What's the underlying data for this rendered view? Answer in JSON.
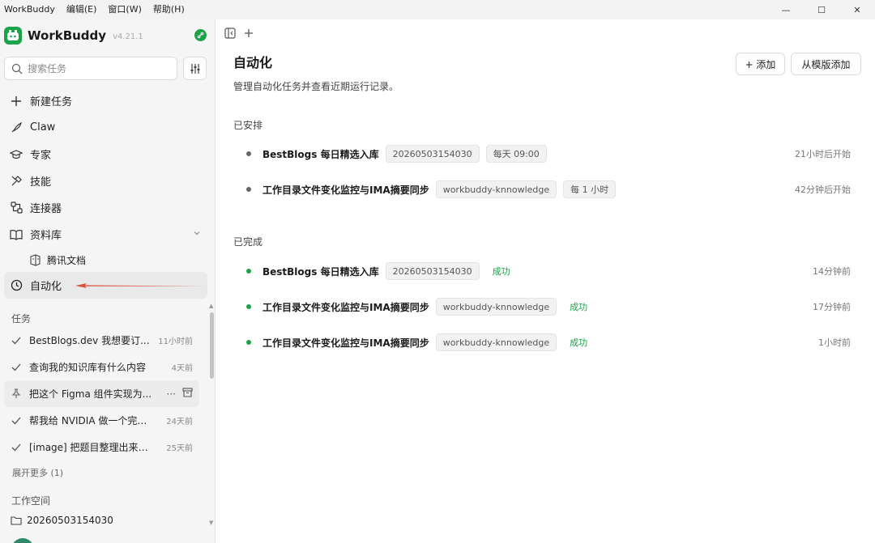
{
  "menubar": {
    "app_name": "WorkBuddy",
    "items": [
      "编辑(E)",
      "窗口(W)",
      "帮助(H)"
    ]
  },
  "window_controls": {
    "minimize": "—",
    "maximize": "☐",
    "close": "✕"
  },
  "brand": {
    "name": "WorkBuddy",
    "version": "v4.21.1",
    "color": "#1aa34a"
  },
  "search": {
    "placeholder": "搜索任务"
  },
  "nav": {
    "new_task": "新建任务",
    "claw": "Claw",
    "experts": "专家",
    "skills": "技能",
    "connectors": "连接器",
    "library": "资料库",
    "library_sub": "腾讯文档",
    "automation": "自动化"
  },
  "tasks": {
    "section_label": "任务",
    "items": [
      {
        "title": "BestBlogs.dev 我想要订...",
        "time": "11小时前"
      },
      {
        "title": "查询我的知识库有什么内容",
        "time": "4天前"
      },
      {
        "title": "把这个 Figma 组件实现为...",
        "time": ""
      },
      {
        "title": "帮我给 NVIDIA 做一个完整...",
        "time": "24天前"
      },
      {
        "title": "[image] 把题目整理出来，...",
        "time": "25天前"
      }
    ],
    "actions_more": "···",
    "expand_more": "展开更多 (1)"
  },
  "workspace": {
    "section_label": "工作空间",
    "folder": "20260503154030"
  },
  "main": {
    "title": "自动化",
    "subtitle": "管理自动化任务并查看近期运行记录。",
    "add_button": "+ 添加",
    "template_button": "从模版添加",
    "scheduled_label": "已安排",
    "scheduled": [
      {
        "name": "BestBlogs 每日精选入库",
        "tag1": "20260503154030",
        "tag2": "每天 09:00",
        "time": "21小时后开始"
      },
      {
        "name": "工作目录文件变化监控与IMA摘要同步",
        "tag1": "workbuddy-knnowledge",
        "tag2": "每 1 小时",
        "time": "42分钟后开始"
      }
    ],
    "done_label": "已完成",
    "done": [
      {
        "name": "BestBlogs 每日精选入库",
        "tag1": "20260503154030",
        "status": "成功",
        "time": "14分钟前"
      },
      {
        "name": "工作目录文件变化监控与IMA摘要同步",
        "tag1": "workbuddy-knnowledge",
        "status": "成功",
        "time": "17分钟前"
      },
      {
        "name": "工作目录文件变化监控与IMA摘要同步",
        "tag1": "workbuddy-knnowledge",
        "status": "成功",
        "time": "1小时前"
      }
    ]
  },
  "colors": {
    "success": "#1aa34a",
    "annotation_arrow": "#d9503c"
  }
}
